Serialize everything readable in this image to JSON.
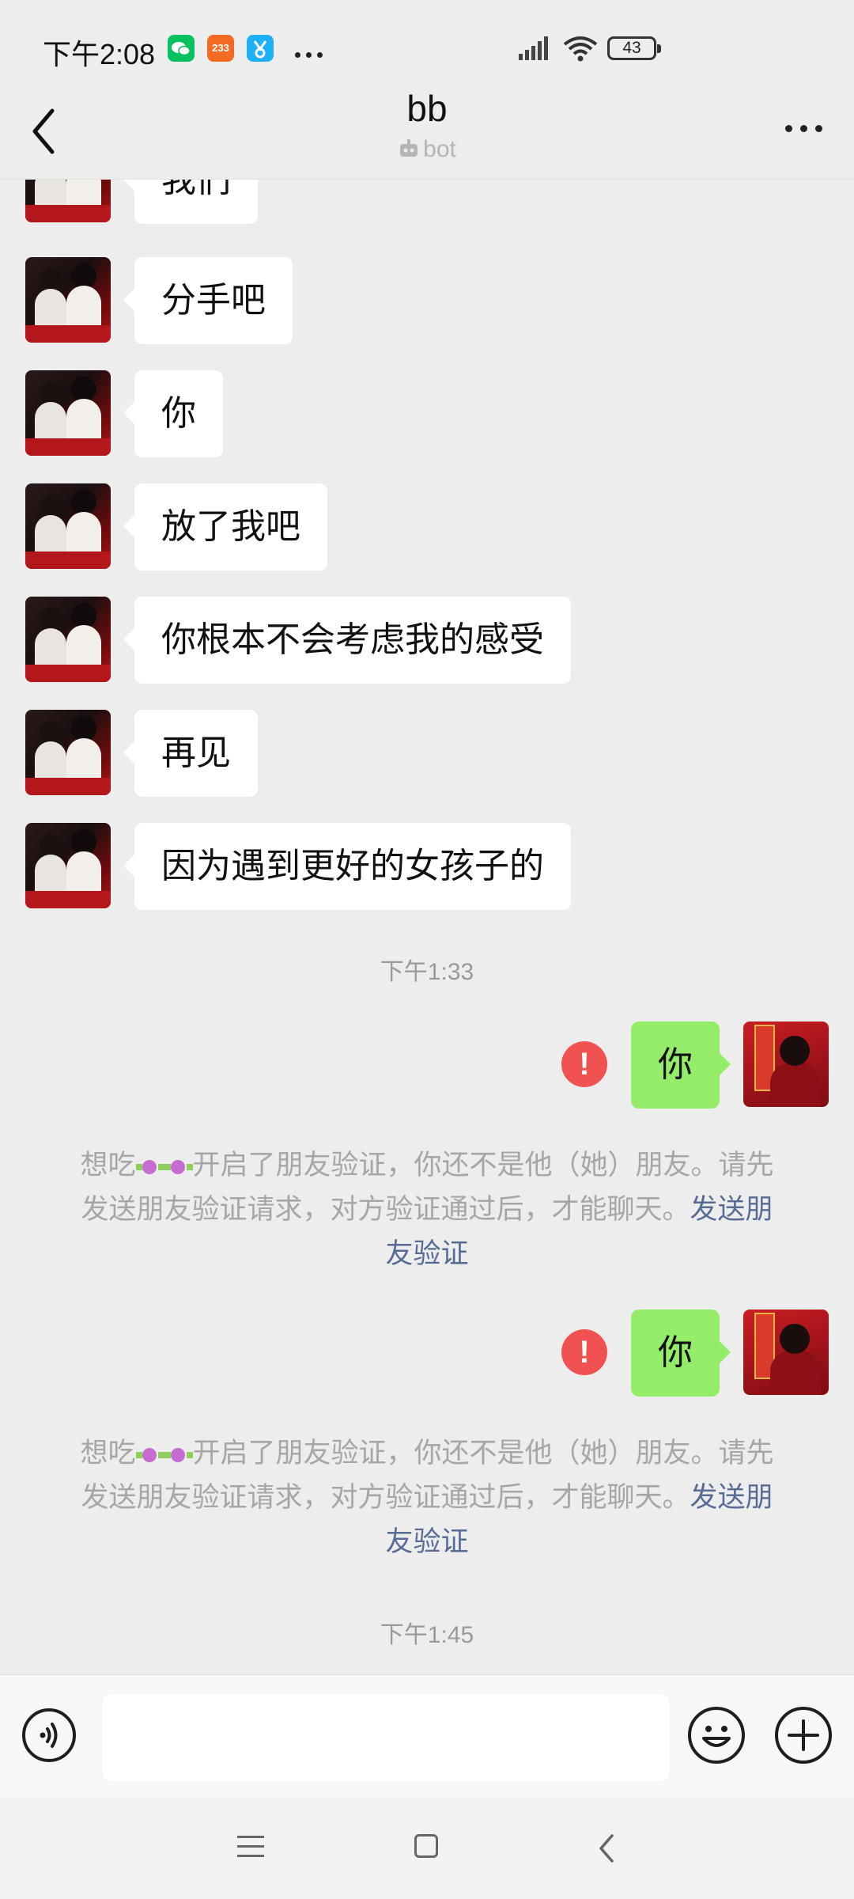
{
  "status_bar": {
    "time": "下午2:08",
    "app_icons": [
      {
        "name": "wechat-icon",
        "color": "#07c160"
      },
      {
        "name": "bilibili-233-icon",
        "color": "#f36a22",
        "text": "233"
      },
      {
        "name": "qq-icon",
        "color": "#1eb0f5"
      }
    ],
    "battery": "43"
  },
  "header": {
    "back_icon": "chevron-left-icon",
    "title": "bb",
    "subtitle": "bot",
    "more_icon": "more-horizontal-icon"
  },
  "messages": [
    {
      "side": "left",
      "text": "我们"
    },
    {
      "side": "left",
      "text": "分手吧"
    },
    {
      "side": "left",
      "text": "你"
    },
    {
      "side": "left",
      "text": "放了我吧"
    },
    {
      "side": "left",
      "text": "你根本不会考虑我的感受"
    },
    {
      "side": "left",
      "text": "再见"
    },
    {
      "side": "left",
      "text": "因为遇到更好的女孩子的"
    }
  ],
  "timestamps": [
    "下午1:33",
    "下午1:45"
  ],
  "sent": [
    {
      "text": "你",
      "status": "failed",
      "status_symbol": "!"
    },
    {
      "text": "你",
      "status": "failed",
      "status_symbol": "!"
    }
  ],
  "system_notice": {
    "before_emoji": "想吃",
    "after_emoji": "开启了朋友验证，你还不是他（她）朋友。请先发送朋友验证请求，对方验证通过后，才能聊天。",
    "link": "发送朋友验证"
  },
  "input_bar": {
    "voice_icon": "voice-icon",
    "emoji_icon": "emoji-icon",
    "plus_icon": "plus-icon"
  },
  "nav_bar": {
    "menu_icon": "menu-icon",
    "home_icon": "home-icon",
    "back_icon": "back-icon"
  },
  "colors": {
    "background": "#ededed",
    "sent_bubble": "#95ec69",
    "received_bubble": "#ffffff",
    "link": "#576b95",
    "error": "#f05252"
  }
}
